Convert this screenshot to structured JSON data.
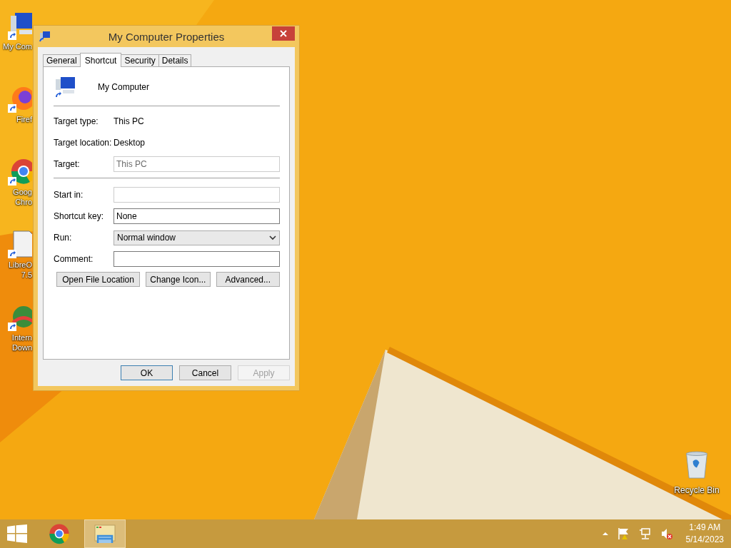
{
  "desktop_icons": [
    {
      "kind": "computer",
      "lines": [
        "My Com"
      ]
    },
    {
      "kind": "firefox",
      "lines": [
        "Firef"
      ]
    },
    {
      "kind": "chrome",
      "lines": [
        "Goog",
        "Chro"
      ]
    },
    {
      "kind": "document",
      "lines": [
        "LibreO",
        "7.5"
      ]
    },
    {
      "kind": "globe",
      "lines": [
        "Intern",
        "Down"
      ]
    },
    {
      "kind": "recycle",
      "lines": [
        "Recycle Bin"
      ]
    }
  ],
  "window": {
    "title": "My Computer Properties",
    "tabs": [
      {
        "label": "General",
        "selected": false
      },
      {
        "label": "Shortcut",
        "selected": true
      },
      {
        "label": "Security",
        "selected": false
      },
      {
        "label": "Details",
        "selected": false
      }
    ],
    "shortcut_name": "My Computer",
    "fields": [
      {
        "kind": "info",
        "label": "Target type:",
        "value": "This PC"
      },
      {
        "kind": "info",
        "label": "Target location:",
        "value": "Desktop"
      },
      {
        "kind": "input",
        "label": "Target:",
        "value": "This PC",
        "disabled": true
      },
      {
        "kind": "divider"
      },
      {
        "kind": "input",
        "label": "Start in:",
        "disabled": true
      },
      {
        "kind": "input",
        "label": "Shortcut key:",
        "value": "None",
        "disabled": false
      },
      {
        "kind": "select",
        "label": "Run:",
        "value": "Normal window"
      },
      {
        "kind": "input",
        "label": "Comment:",
        "disabled": false
      }
    ],
    "actions": [
      "Open File Location",
      "Change Icon...",
      "Advanced..."
    ],
    "buttons": [
      {
        "label": "OK",
        "disabled": false,
        "default": true
      },
      {
        "label": "Cancel",
        "disabled": false,
        "default": false
      },
      {
        "label": "Apply",
        "disabled": true,
        "default": false
      }
    ]
  },
  "taskbar": {
    "apps": [
      {
        "kind": "chrome",
        "selected": false
      },
      {
        "kind": "explorer",
        "selected": true
      }
    ],
    "time": "1:49 AM",
    "date": "5/14/2023"
  }
}
